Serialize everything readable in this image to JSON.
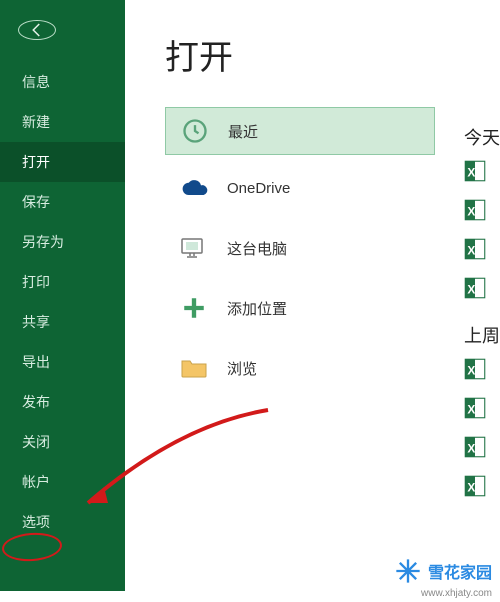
{
  "sidebar": {
    "items": [
      {
        "label": "信息"
      },
      {
        "label": "新建"
      },
      {
        "label": "打开"
      },
      {
        "label": "保存"
      },
      {
        "label": "另存为"
      },
      {
        "label": "打印"
      },
      {
        "label": "共享"
      },
      {
        "label": "导出"
      },
      {
        "label": "发布"
      },
      {
        "label": "关闭"
      }
    ],
    "tail": [
      {
        "label": "帐户"
      },
      {
        "label": "选项"
      }
    ],
    "active_index": 2
  },
  "main": {
    "title": "打开",
    "sources": [
      {
        "label": "最近",
        "icon": "clock"
      },
      {
        "label": "OneDrive",
        "icon": "cloud"
      },
      {
        "label": "这台电脑",
        "icon": "pc"
      },
      {
        "label": "添加位置",
        "icon": "plus"
      },
      {
        "label": "浏览",
        "icon": "folder"
      }
    ],
    "selected_source_index": 0,
    "groups": [
      {
        "label": "今天",
        "count": 4
      },
      {
        "label": "上周",
        "count": 4
      }
    ]
  },
  "watermark": {
    "text": "雪花家园",
    "url": "www.xhjaty.com"
  },
  "colors": {
    "brand_green": "#0e6434",
    "selected_bg": "#d1ead8",
    "excel_green": "#217346",
    "annotation_red": "#d21a1a"
  }
}
